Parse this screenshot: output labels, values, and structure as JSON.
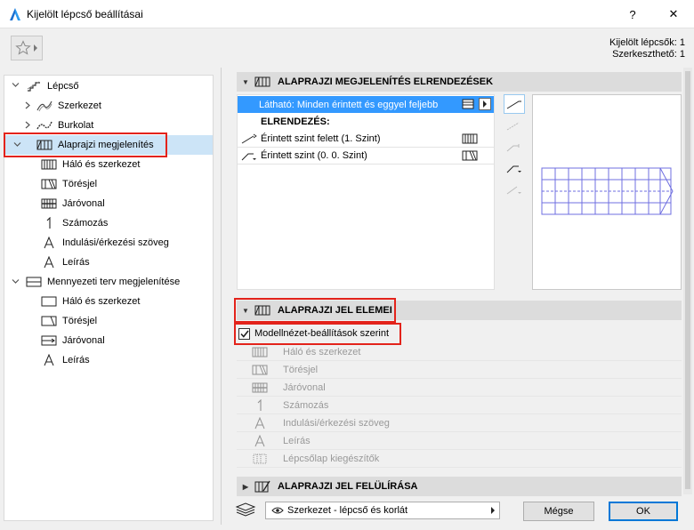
{
  "window": {
    "title": "Kijelölt lépcső beállításai",
    "help": "?",
    "close": "✕"
  },
  "selection": {
    "selected": "Kijelölt lépcsők: 1",
    "editable": "Szerkeszthető: 1"
  },
  "tree": {
    "root": "Lépcső",
    "items": [
      {
        "label": "Szerkezet",
        "icon": "structure-icon"
      },
      {
        "label": "Burkolat",
        "icon": "finish-icon"
      },
      {
        "label": "Alaprajzi megjelenítés",
        "icon": "floor-plan-display-icon"
      },
      {
        "label": "Háló és szerkezet",
        "icon": "grid-structure-icon"
      },
      {
        "label": "Törésjel",
        "icon": "break-mark-icon"
      },
      {
        "label": "Járóvonal",
        "icon": "walking-line-icon"
      },
      {
        "label": "Számozás",
        "icon": "numbering-icon"
      },
      {
        "label": "Indulási/érkezési szöveg",
        "icon": "text-icon"
      },
      {
        "label": "Leírás",
        "icon": "description-icon"
      },
      {
        "label": "Mennyezeti terv megjelenítése",
        "icon": "ceiling-plan-icon"
      },
      {
        "label": "Háló és szerkezet",
        "icon": "grid-structure-icon"
      },
      {
        "label": "Törésjel",
        "icon": "break-mark-icon"
      },
      {
        "label": "Járóvonal",
        "icon": "walking-line-icon"
      },
      {
        "label": "Leírás",
        "icon": "description-icon"
      }
    ]
  },
  "layout_panel": {
    "title": "ALAPRAJZI MEGJELENÍTÉS ELRENDEZÉSEK",
    "visible": "Látható: Minden érintett és eggyel feljebb",
    "layout_header": "ELRENDEZÉS:",
    "rows": [
      {
        "label": "Érintett szint felett (1. Szint)"
      },
      {
        "label": "Érintett szint (0. 0. Szint)"
      }
    ]
  },
  "elements_panel": {
    "title": "ALAPRAJZI JEL ELEMEI",
    "checkbox": "Modellnézet-beállítások szerint",
    "checked": true,
    "items": [
      "Háló és szerkezet",
      "Törésjel",
      "Járóvonal",
      "Számozás",
      "Indulási/érkezési szöveg",
      "Leírás",
      "Lépcsőlap kiegészítők"
    ]
  },
  "override_panel": {
    "title": "ALAPRAJZI JEL FELÜLÍRÁSA"
  },
  "footer": {
    "layer": "Szerkezet - lépcső és korlát",
    "cancel": "Mégse",
    "ok": "OK"
  },
  "colors": {
    "highlight": "#3399ff",
    "selection_bg": "#cce4f7",
    "red_annotation": "#e3231b",
    "stair_lines": "#6f6fe0"
  }
}
